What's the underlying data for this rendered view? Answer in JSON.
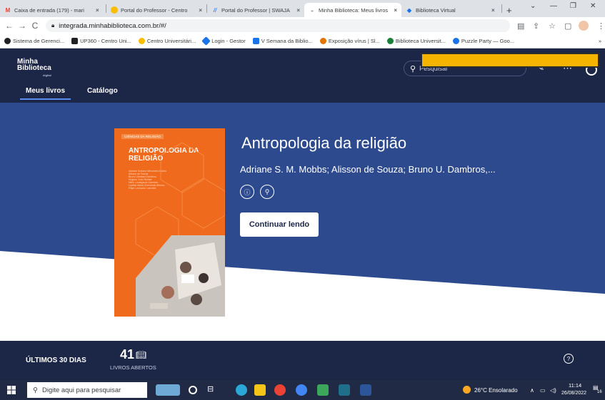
{
  "browser": {
    "tabs": [
      {
        "title": "Caixa de entrada (179) - mari",
        "icon": "gmail-icon",
        "color": "#ea4335",
        "glyph": "M"
      },
      {
        "title": "Portal do Professor - Centro",
        "icon": "portal-icon",
        "color": "#fbbc04",
        "glyph": "●"
      },
      {
        "title": "Portal do Professor | SWAJA",
        "icon": "swaja-icon",
        "color": "#4285f4",
        "glyph": "//"
      },
      {
        "title": "Minha Biblioteca: Meus livros",
        "icon": "library-icon",
        "color": "#9aa0a6",
        "glyph": "◒"
      },
      {
        "title": "Biblioteca Virtual",
        "icon": "virtual-library-icon",
        "color": "#1a73e8",
        "glyph": "◆"
      }
    ],
    "active_tab": 3,
    "url": "integrada.minhabiblioteca.com.br/#/",
    "bookmarks": [
      {
        "label": "Sistema de Gerenci...",
        "color": "#202124"
      },
      {
        "label": "UP360 - Centro Uni...",
        "color": "#202124"
      },
      {
        "label": "Centro Universitári...",
        "color": "#fbbc04"
      },
      {
        "label": "Login - Gestor",
        "color": "#1a73e8"
      },
      {
        "label": "V Semana da Biblio...",
        "color": "#1a73e8"
      },
      {
        "label": "Exposição vírus | Sl...",
        "color": "#e37400"
      },
      {
        "label": "Biblioteca Universit...",
        "color": "#188038"
      },
      {
        "label": "Puzzle Party — Goo...",
        "color": "#1a73e8"
      }
    ]
  },
  "site": {
    "logo_line1": "Minha",
    "logo_line2": "Biblioteca",
    "logo_small": "digital",
    "search_placeholder": "Pesquisar",
    "nav_tabs": [
      "Meus livros",
      "Catálogo"
    ]
  },
  "book": {
    "title": "Antropologia da religião",
    "authors": "Adriane S. M. Mobbs; Alisson de Souza; Bruno U. Dambros,...",
    "cta": "Continuar lendo",
    "cover_category": "CIÊNCIAS DA RELIGIÃO",
    "cover_title": "ANTROPOLOGIA DA RELIGIÃO",
    "cover_authors": [
      "Adriane Soriano Mercedes Mobbs",
      "Alisson de Souza",
      "Bruno Ubiratan Dambros",
      "Hugues Jorio Richter",
      "Hélio Lindegardo Gaertner",
      "Lucélia Maria Zeremeski Alfonso",
      "Filipe Leonardo Lancelot"
    ]
  },
  "stats": {
    "label": "ÚLTIMOS 30 DIAS",
    "count": "41",
    "sub": "LIVROS ABERTOS"
  },
  "taskbar": {
    "search_placeholder": "Digite aqui para pesquisar",
    "weather": "26°C Ensolarado",
    "time": "11:14",
    "date": "26/08/2022",
    "notifications": "16"
  }
}
